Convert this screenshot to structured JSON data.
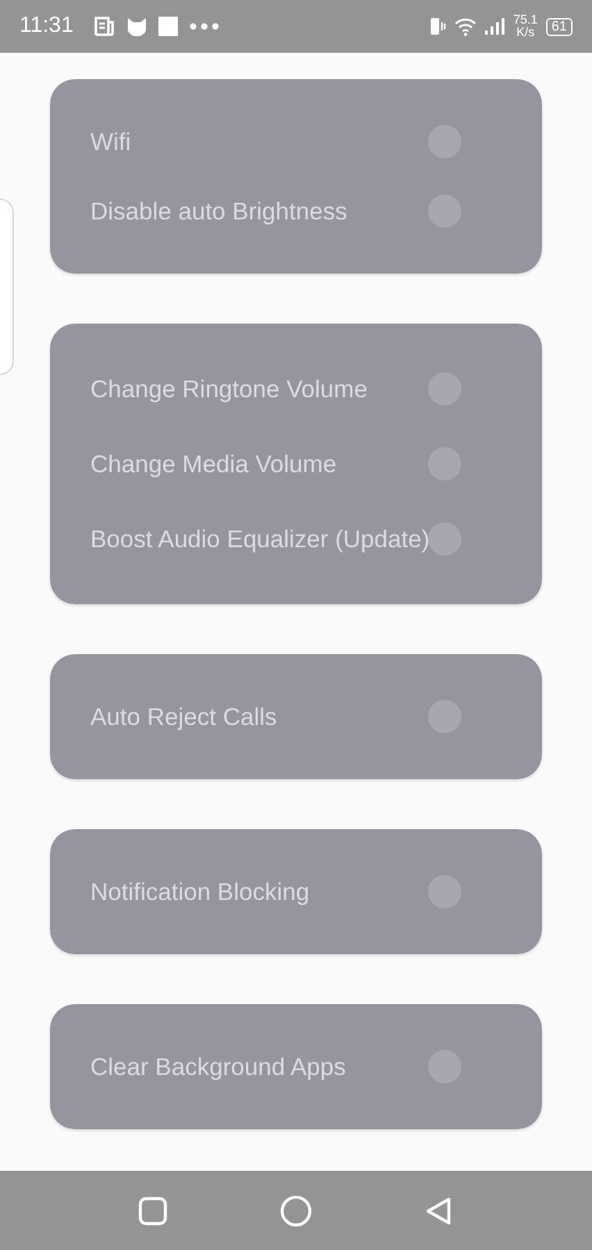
{
  "status_bar": {
    "time": "11:31",
    "net_speed": "75.1",
    "net_unit": "K/s",
    "battery": "61"
  },
  "cards": [
    {
      "rows": [
        {
          "label": "Wifi",
          "on": false
        },
        {
          "label": "Disable auto Brightness",
          "on": false
        }
      ]
    },
    {
      "rows": [
        {
          "label": "Change Ringtone Volume",
          "on": false
        },
        {
          "label": "Change Media Volume",
          "on": false
        },
        {
          "label": "Boost Audio Equalizer (Update)",
          "on": false
        }
      ]
    },
    {
      "rows": [
        {
          "label": "Auto Reject Calls",
          "on": false
        }
      ]
    },
    {
      "rows": [
        {
          "label": "Notification Blocking",
          "on": false
        }
      ]
    },
    {
      "rows": [
        {
          "label": "Clear Background Apps",
          "on": false
        }
      ]
    }
  ]
}
